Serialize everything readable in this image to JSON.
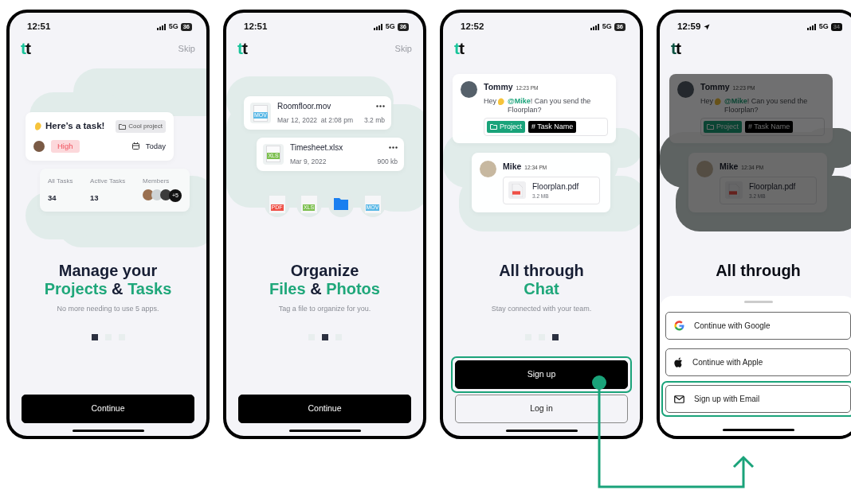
{
  "screens": [
    {
      "kind": "tasks",
      "dimmed": false,
      "status": {
        "time": "12:51",
        "network": "5G",
        "battery": "36",
        "location": false
      },
      "logo": "tt",
      "skip": "Skip",
      "task": {
        "title": "Here’s a task!",
        "project": "Cool project",
        "priority": "High",
        "due": "Today"
      },
      "stats": [
        {
          "label": "All Tasks",
          "value": "34"
        },
        {
          "label": "Active Tasks",
          "value": "13"
        }
      ],
      "members": {
        "label": "Members",
        "more": "+5"
      },
      "headline": [
        "Manage your",
        "**Projects** & **Tasks**"
      ],
      "subtitle": "No more needing to use 5 apps.",
      "pager": [
        {
          "selected": true
        },
        {
          "selected": false
        },
        {
          "selected": false
        }
      ],
      "buttons": [
        {
          "kind": "primary",
          "label": "Continue",
          "highlighted": false
        }
      ]
    },
    {
      "kind": "files",
      "dimmed": false,
      "status": {
        "time": "12:51",
        "network": "5G",
        "battery": "36",
        "location": false
      },
      "logo": "tt",
      "skip": "Skip",
      "files": [
        {
          "name": "Roomfloor.mov",
          "date": "Mar 12, 2022  at 2:08 pm",
          "size": "3.2 mb",
          "type": "MOV"
        },
        {
          "name": "Timesheet.xlsx",
          "date": "Mar 9, 2022",
          "size": "900 kb",
          "type": "XLS"
        }
      ],
      "file_types": [
        {
          "kind": "doc",
          "type": "PDF",
          "color": "#ef4f45"
        },
        {
          "kind": "doc",
          "type": "XLS",
          "color": "#7cbf4e"
        },
        {
          "kind": "folder"
        },
        {
          "kind": "doc",
          "type": "MOV",
          "color": "#5ab8e6"
        }
      ],
      "headline": [
        "Organize",
        "**Files** & **Photos**"
      ],
      "subtitle": "Tag a file to organize for you.",
      "pager": [
        {
          "selected": false
        },
        {
          "selected": true
        },
        {
          "selected": false
        }
      ],
      "buttons": [
        {
          "kind": "primary",
          "label": "Continue",
          "highlighted": false
        }
      ]
    },
    {
      "kind": "chat",
      "dimmed": false,
      "status": {
        "time": "12:52",
        "network": "5G",
        "battery": "36",
        "location": false
      },
      "logo": "tt",
      "messages": [
        {
          "author": "Tommy",
          "time": "12:23 PM",
          "text_start": "Hey",
          "text_rest": "**@Mike**! Can you send the Floorplan?",
          "tags": [
            {
              "kind": "project",
              "label": "Project"
            },
            {
              "kind": "task",
              "label": "# Task Name"
            }
          ]
        },
        {
          "author": "Mike",
          "time": "12:34 PM",
          "attachment": {
            "name": "Floorplan.pdf",
            "size": "3.2 MB"
          }
        }
      ],
      "headline": [
        "All through",
        "**Chat**"
      ],
      "subtitle": "Stay connected with your team.",
      "pager": [
        {
          "selected": false
        },
        {
          "selected": false
        },
        {
          "selected": true
        }
      ],
      "buttons": [
        {
          "kind": "primary",
          "label": "Sign up",
          "highlighted": true
        },
        {
          "kind": "outline",
          "label": "Log in",
          "highlighted": false
        }
      ]
    },
    {
      "kind": "chat",
      "dimmed": true,
      "status": {
        "time": "12:59",
        "network": "5G",
        "battery": "34",
        "location": true
      },
      "logo": "tt",
      "messages": [
        {
          "author": "Tommy",
          "time": "12:23 PM",
          "text_start": "Hey",
          "text_rest": "**@Mike**! Can you send the Floorplan?",
          "tags": [
            {
              "kind": "project",
              "label": "Project"
            },
            {
              "kind": "task",
              "label": "# Task Name"
            }
          ]
        },
        {
          "author": "Mike",
          "time": "12:34 PM",
          "attachment": {
            "name": "Floorplan.pdf",
            "size": "3.2 MB"
          }
        }
      ],
      "headline": [
        "All through"
      ],
      "sheet": {
        "buttons": [
          {
            "kind": "google",
            "label": "Continue with Google",
            "highlighted": false
          },
          {
            "kind": "apple",
            "label": "Continue with Apple",
            "highlighted": false
          },
          {
            "kind": "email",
            "label": "Sign up with Email",
            "highlighted": true
          }
        ]
      }
    }
  ]
}
